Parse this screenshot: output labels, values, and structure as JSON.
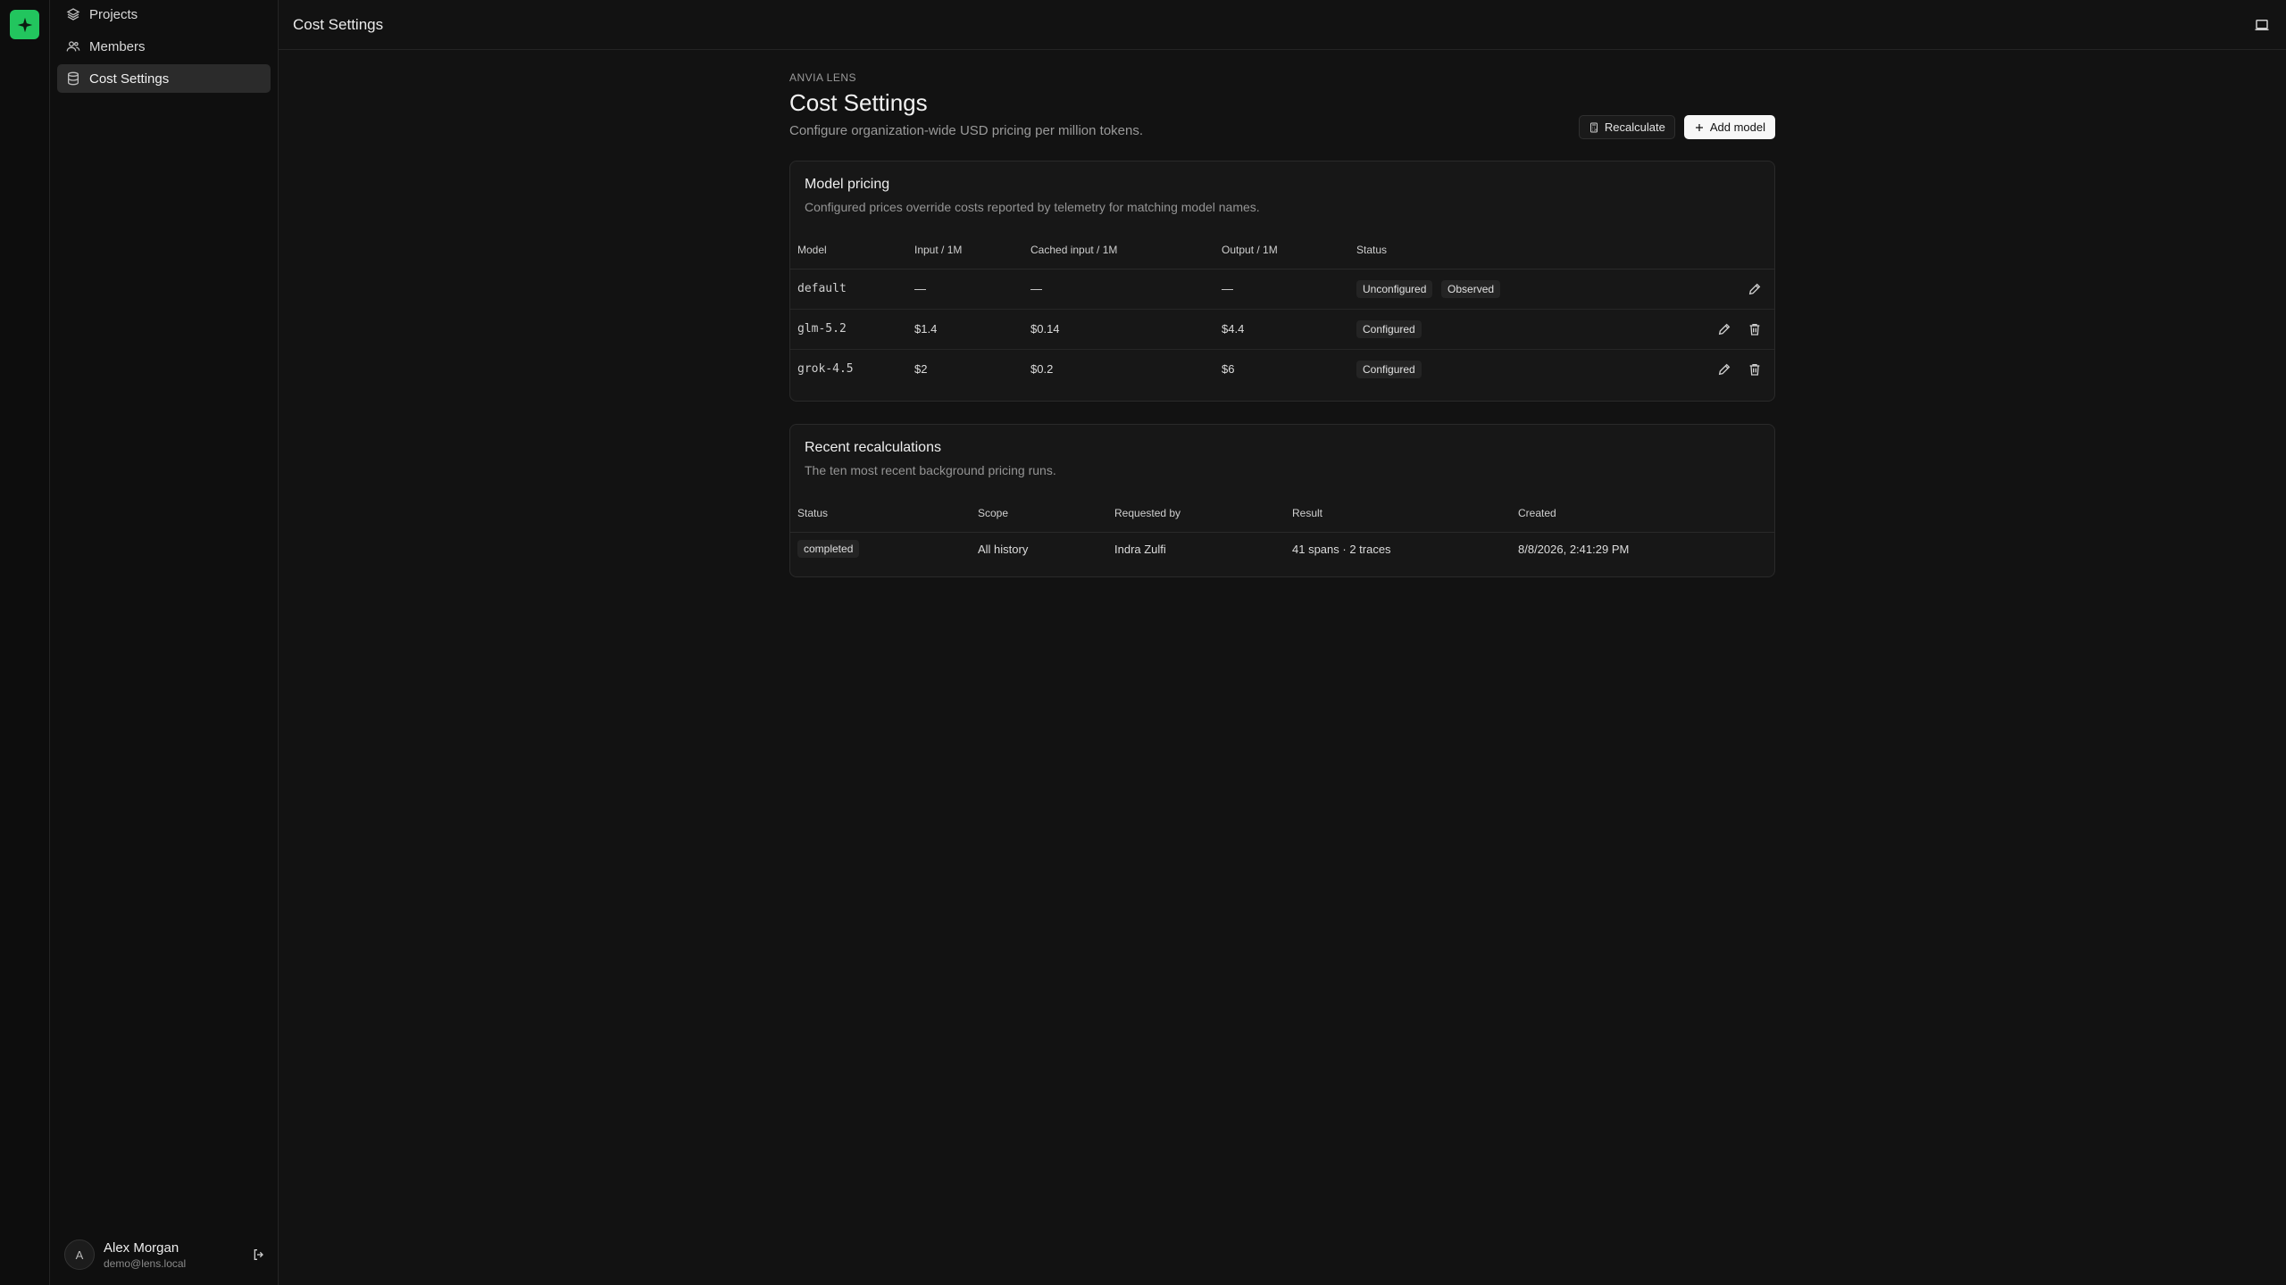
{
  "app": {
    "accent": "#22c55e"
  },
  "sidebar": {
    "items": [
      {
        "label": "Projects",
        "icon": "layers-icon"
      },
      {
        "label": "Members",
        "icon": "users-icon"
      },
      {
        "label": "Cost Settings",
        "icon": "database-icon",
        "active": true
      }
    ],
    "user": {
      "initial": "A",
      "name": "Alex Morgan",
      "email": "demo@lens.local"
    }
  },
  "topbar": {
    "title": "Cost Settings"
  },
  "page": {
    "eyebrow": "ANVIA LENS",
    "title": "Cost Settings",
    "subtitle": "Configure organization-wide USD pricing per million tokens.",
    "recalculate_label": "Recalculate",
    "add_model_label": "Add model"
  },
  "pricing": {
    "title": "Model pricing",
    "subtitle": "Configured prices override costs reported by telemetry for matching model names.",
    "headers": [
      "Model",
      "Input / 1M",
      "Cached input / 1M",
      "Output / 1M",
      "Status"
    ],
    "rows": [
      {
        "model": "default",
        "input": "—",
        "cached": "—",
        "output": "—",
        "badges": [
          "Unconfigured",
          "Observed"
        ]
      },
      {
        "model": "glm-5.2",
        "input": "$1.4",
        "cached": "$0.14",
        "output": "$4.4",
        "badges": [
          "Configured"
        ]
      },
      {
        "model": "grok-4.5",
        "input": "$2",
        "cached": "$0.2",
        "output": "$6",
        "badges": [
          "Configured"
        ]
      }
    ]
  },
  "recalc": {
    "title": "Recent recalculations",
    "subtitle": "The ten most recent background pricing runs.",
    "headers": [
      "Status",
      "Scope",
      "Requested by",
      "Result",
      "Created"
    ],
    "rows": [
      {
        "status": "completed",
        "scope": "All history",
        "requested_by": "Indra Zulfi",
        "result": "41 spans · 2 traces",
        "created": "8/8/2026, 2:41:29 PM"
      }
    ]
  }
}
